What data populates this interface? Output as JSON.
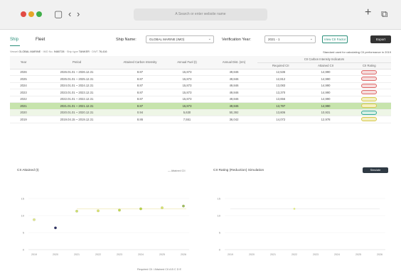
{
  "browser": {
    "address": "A  Search or enter website name"
  },
  "tabs": [
    {
      "label": "Ship"
    },
    {
      "label": "Fleet"
    }
  ],
  "filters": {
    "ship_name_label": "Ship Name:",
    "ship_name_value": "GLOBAL MARINE (IMO)",
    "year_label": "Verification Year:",
    "year_value": "2021 - 1",
    "view_button": "View CII Factor",
    "export_button": "Export"
  },
  "breadcrumb": [
    {
      "key": "Vessel",
      "value": "GLOBAL MARINE"
    },
    {
      "key": "IMO No.",
      "value": "9460728"
    },
    {
      "key": "Ship type",
      "value": "TANKER"
    },
    {
      "key": "DWT",
      "value": "76,416"
    }
  ],
  "standard_note": "Standard used for calculating CII performance in 2019",
  "table": {
    "headers": [
      "Year",
      "Period",
      "Attained Carbon Intensity",
      "Annual Fuel (t)",
      "Annual Dist. (nm)"
    ],
    "group_header": "CII Carbon Intensity Indicators",
    "sub_headers": [
      "Required CII",
      "Attained CII",
      "CII Rating"
    ],
    "rows": [
      {
        "year": "2026",
        "period": "2026.01.01 ~ 2026.12.31",
        "aci": "8.87",
        "fuel": "15,873",
        "dist": "49,846",
        "req": "12,536",
        "att": "14,990",
        "rating": "E",
        "style": "",
        "rc": ""
      },
      {
        "year": "2025",
        "period": "2025.01.01 ~ 2025.12.31",
        "aci": "8.87",
        "fuel": "15,873",
        "dist": "49,846",
        "req": "12,812",
        "att": "14,990",
        "rating": "E",
        "style": "",
        "rc": ""
      },
      {
        "year": "2024",
        "period": "2024.01.01 ~ 2024.12.31",
        "aci": "8.87",
        "fuel": "15,873",
        "dist": "49,846",
        "req": "13,083",
        "att": "14,990",
        "rating": "E",
        "style": "",
        "rc": ""
      },
      {
        "year": "2023",
        "period": "2023.01.01 ~ 2023.12.31",
        "aci": "8.87",
        "fuel": "15,873",
        "dist": "49,846",
        "req": "13,370",
        "att": "14,990",
        "rating": "E",
        "style": "",
        "rc": ""
      },
      {
        "year": "2022",
        "period": "2022.01.01 ~ 2022.12.31",
        "aci": "8.87",
        "fuel": "15,873",
        "dist": "49,846",
        "req": "13,656",
        "att": "14,990",
        "rating": "D",
        "style": "",
        "rc": "y"
      },
      {
        "year": "2021",
        "period": "2021.01.01 ~ 2021.12.31",
        "aci": "8.87",
        "fuel": "15,873",
        "dist": "49,846",
        "req": "13,797",
        "att": "14,990",
        "rating": "D",
        "style": "hl",
        "rc": "y"
      },
      {
        "year": "2020",
        "period": "2020.01.01 ~ 2020.12.31",
        "aci": "0.94",
        "fuel": "5,630",
        "dist": "50,392",
        "req": "13,606",
        "att": "10,931",
        "rating": "B",
        "style": "hl2",
        "rc": "g"
      },
      {
        "year": "2019",
        "period": "2019.04.15 ~ 2019.12.31",
        "aci": "8.86",
        "fuel": "7,551",
        "dist": "36,042",
        "req": "14,072",
        "att": "12,978",
        "rating": "C",
        "style": "",
        "rc": "y"
      }
    ]
  },
  "left_chart": {
    "title": "CII Attained (t)",
    "legend": "Attained CII"
  },
  "right_chart": {
    "title": "CII Rating (Reduction) Simulation",
    "button": "Simulate"
  },
  "bottom_legend": "Required CII  /  Attained CII  A  B  C  D  E",
  "chart_data": [
    {
      "type": "scatter",
      "title": "CII Attained (t)",
      "x": [
        "2019",
        "2020",
        "2021",
        "2022",
        "2023",
        "2024",
        "2025",
        "2026"
      ],
      "ylim": [
        0,
        20
      ],
      "series": [
        {
          "name": "Attained CII",
          "values": [
            8.8,
            6.4,
            11.3,
            11.4,
            11.6,
            12.0,
            12.3,
            12.8
          ]
        }
      ],
      "yticks": [
        "0",
        "5",
        "10",
        "15"
      ]
    },
    {
      "type": "line",
      "title": "CII Rating (Reduction) Simulation",
      "x": [
        "2019",
        "2020",
        "2021",
        "2022",
        "2023",
        "2024",
        "2025",
        "2026"
      ],
      "ylim": [
        0,
        20
      ],
      "series": [
        {
          "name": "Required CII",
          "values": [
            12,
            12,
            12,
            12,
            12,
            12,
            12,
            12
          ]
        }
      ],
      "yticks": [
        "0",
        "5",
        "10",
        "15"
      ]
    }
  ],
  "colors": {
    "accent": "#2a8f7a",
    "highlight_row": "#c7e4ad"
  }
}
